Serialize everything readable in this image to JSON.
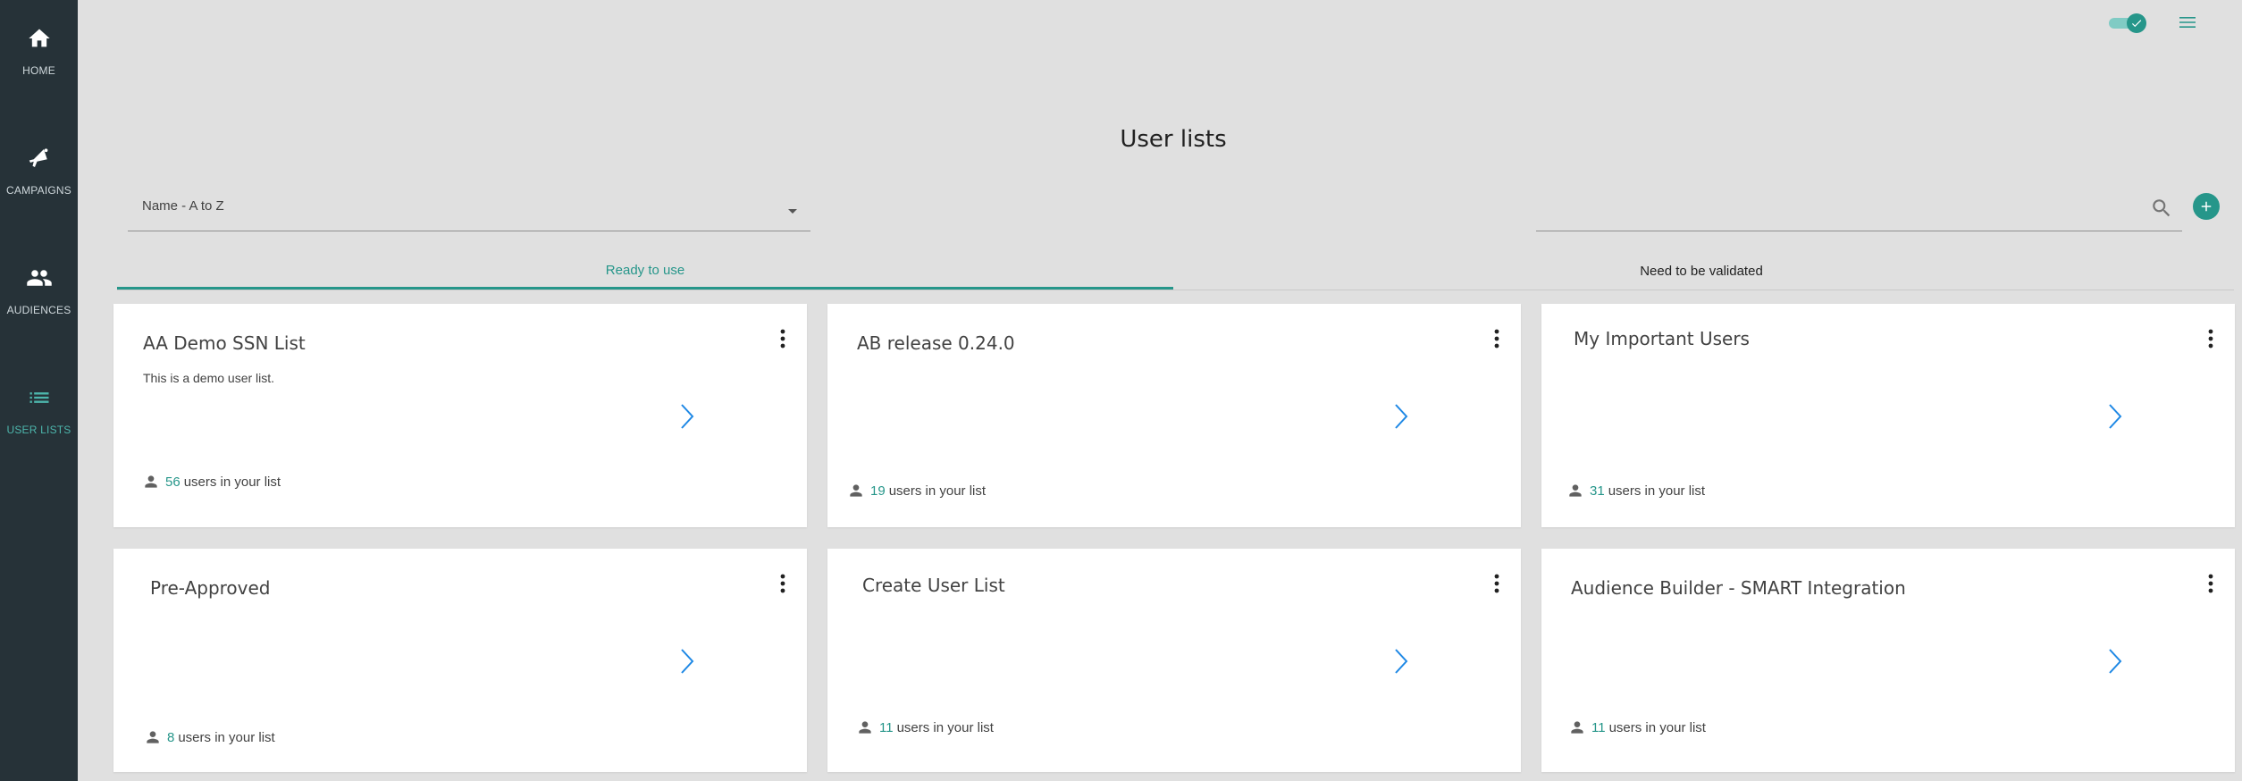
{
  "sidebar": {
    "items": [
      {
        "label": "HOME",
        "icon": "home-icon"
      },
      {
        "label": "CAMPAIGNS",
        "icon": "megaphone-icon"
      },
      {
        "label": "AUDIENCES",
        "icon": "people-icon"
      },
      {
        "label": "USER LISTS",
        "icon": "list-icon",
        "active": true
      }
    ]
  },
  "header": {
    "title": "User lists"
  },
  "filters": {
    "sort_value": "Name - A to Z",
    "search_value": ""
  },
  "tabs": [
    {
      "label": "Ready to use",
      "active": true
    },
    {
      "label": "Need to be validated",
      "active": false
    }
  ],
  "cards": [
    {
      "title": "AA Demo SSN List",
      "description": "This is a demo user list.",
      "count": "56",
      "count_suffix": "users in your list"
    },
    {
      "title": "AB release 0.24.0",
      "description": "",
      "count": "19",
      "count_suffix": "users in your list"
    },
    {
      "title": "My Important Users",
      "description": "",
      "count": "31",
      "count_suffix": "users in your list"
    },
    {
      "title": "Pre-Approved",
      "description": "",
      "count": "8",
      "count_suffix": "users in your list"
    },
    {
      "title": "Create User List",
      "description": "",
      "count": "11",
      "count_suffix": "users in your list"
    },
    {
      "title": "Audience Builder - SMART Integration",
      "description": "",
      "count": "11",
      "count_suffix": "users in your list"
    }
  ],
  "colors": {
    "sidebar_bg": "#263238",
    "accent": "#26968a",
    "page_bg": "#e0e0e0",
    "chevron": "#1e88e5"
  }
}
